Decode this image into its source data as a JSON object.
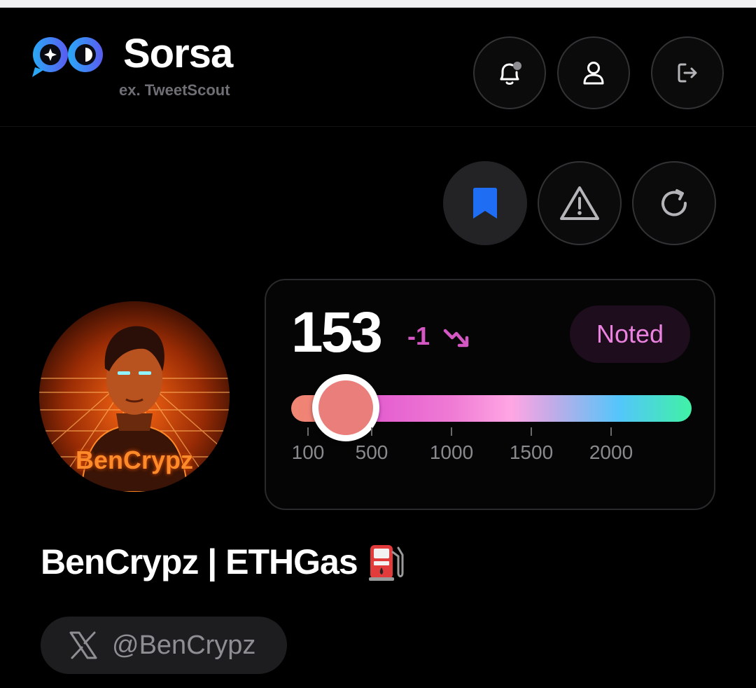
{
  "app": {
    "name": "Sorsa",
    "subtitle": "ex. TweetScout"
  },
  "header_actions": [
    {
      "icon": "bell-notification-icon"
    },
    {
      "icon": "user-icon"
    },
    {
      "icon": "logout-icon"
    }
  ],
  "profile_actions": [
    {
      "icon": "bookmark-icon",
      "active": true,
      "color": "#1f6df2"
    },
    {
      "icon": "warning-icon"
    },
    {
      "icon": "refresh-icon"
    }
  ],
  "score_card": {
    "score": "153",
    "delta": "-1",
    "trend_icon": "trend-down-icon",
    "level_badge": "Noted",
    "slider_value": 153,
    "slider_min": 0,
    "slider_max": 2500,
    "tick_labels": [
      "100",
      "500",
      "1000",
      "1500",
      "2000"
    ]
  },
  "profile": {
    "avatar_text": "BenCrypz",
    "display_name": "BenCrypz | ETHGas",
    "name_emoji_icon": "fuel-pump-icon",
    "handle": "@BenCrypz",
    "handle_icon": "x-logo-icon"
  },
  "colors": {
    "background": "#000000",
    "badge_text": "#ec82e0",
    "delta": "#d457c4",
    "bookmark_blue": "#1f6df2"
  }
}
